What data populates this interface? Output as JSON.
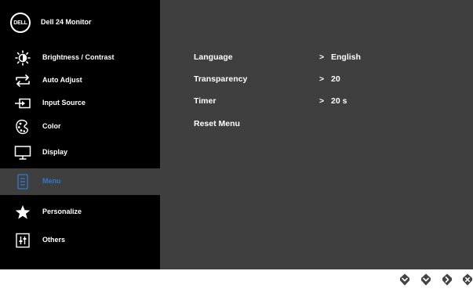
{
  "brand": {
    "logo_text": "DELL",
    "title": "Dell 24 Monitor"
  },
  "sidebar": {
    "items": [
      {
        "label": "Brightness / Contrast",
        "icon": "brightness-icon"
      },
      {
        "label": "Auto Adjust",
        "icon": "auto-adjust-icon"
      },
      {
        "label": "Input Source",
        "icon": "input-source-icon"
      },
      {
        "label": "Color",
        "icon": "color-palette-icon"
      },
      {
        "label": "Display",
        "icon": "display-icon"
      },
      {
        "label": "Menu",
        "icon": "menu-icon",
        "selected": true
      },
      {
        "label": "Personalize",
        "icon": "star-icon"
      },
      {
        "label": "Others",
        "icon": "others-icon"
      }
    ]
  },
  "menu_settings": {
    "rows": [
      {
        "label": "Language",
        "arrow": ">",
        "value": "English"
      },
      {
        "label": "Transparency",
        "arrow": ">",
        "value": "20"
      },
      {
        "label": "Timer",
        "arrow": ">",
        "value": "20 s"
      },
      {
        "label": "Reset Menu"
      }
    ]
  },
  "bottom_buttons": [
    {
      "icon": "chevron-down-icon"
    },
    {
      "icon": "chevron-down-icon"
    },
    {
      "icon": "chevron-right-icon"
    },
    {
      "icon": "close-icon"
    }
  ],
  "colors": {
    "sidebar_bg": "#000000",
    "panel_bg": "#3f3f3f",
    "accent": "#2f7ad0",
    "text": "#ffffff"
  }
}
